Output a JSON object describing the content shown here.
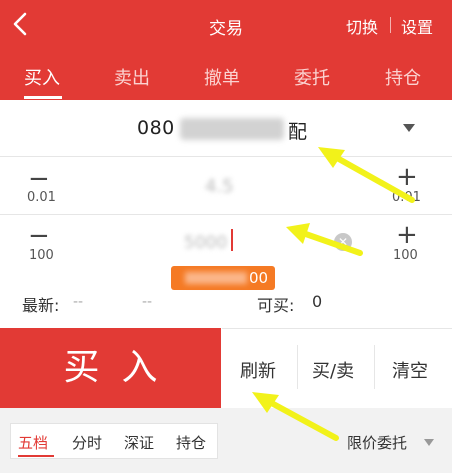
{
  "header": {
    "title": "交易",
    "switch_label": "切换",
    "settings_label": "设置"
  },
  "tabs": [
    {
      "label": "买入",
      "active": true
    },
    {
      "label": "卖出"
    },
    {
      "label": "撤单"
    },
    {
      "label": "委托"
    },
    {
      "label": "持仓"
    }
  ],
  "stock": {
    "code_prefix": "080",
    "name_suffix": "配"
  },
  "price": {
    "value": "4.5",
    "minus": "−",
    "plus": "+",
    "step": "0.01"
  },
  "quantity": {
    "value": "5000",
    "minus": "−",
    "plus": "+",
    "step": "100",
    "max_suffix": "00"
  },
  "quote": {
    "latest_label": "最新:",
    "latest_value": "--",
    "latest_change": "--",
    "can_buy_label": "可买:",
    "can_buy_value": "0"
  },
  "actions": {
    "buy_label": "买入",
    "refresh_label": "刷新",
    "buysell_label": "买/卖",
    "clear_label": "清空"
  },
  "bottom_tabs": [
    {
      "label": "五档",
      "active": true
    },
    {
      "label": "分时"
    },
    {
      "label": "深证"
    },
    {
      "label": "持仓"
    }
  ],
  "order_type": "限价委托",
  "colors": {
    "brand": "#e23a35",
    "badge": "#f57a24",
    "annotation_arrow": "#f2f21a"
  }
}
